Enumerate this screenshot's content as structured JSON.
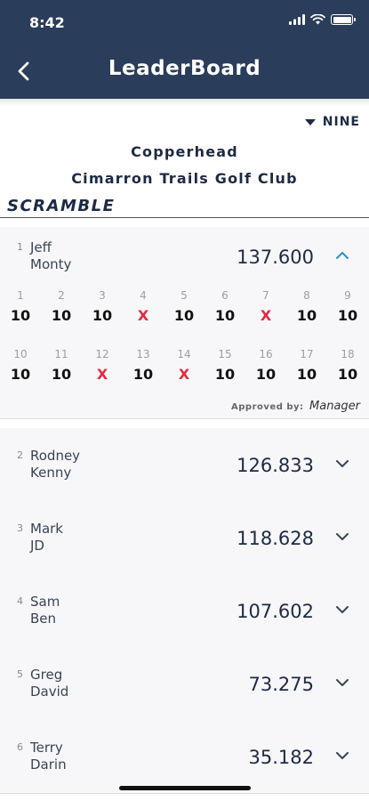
{
  "status": {
    "time": "8:42"
  },
  "nav": {
    "title": "LeaderBoard"
  },
  "filter": {
    "nine": "NINE"
  },
  "event": {
    "course": "Copperhead",
    "club": "Cimarron Trails Golf Club",
    "format": "SCRAMBLE"
  },
  "leader": {
    "rank": "1",
    "player1": "Jeff",
    "player2": "Monty",
    "score": "137.600",
    "holes": [
      {
        "num": "1",
        "score": "10"
      },
      {
        "num": "2",
        "score": "10"
      },
      {
        "num": "3",
        "score": "10"
      },
      {
        "num": "4",
        "score": "X"
      },
      {
        "num": "5",
        "score": "10"
      },
      {
        "num": "6",
        "score": "10"
      },
      {
        "num": "7",
        "score": "X"
      },
      {
        "num": "8",
        "score": "10"
      },
      {
        "num": "9",
        "score": "10"
      },
      {
        "num": "10",
        "score": "10"
      },
      {
        "num": "11",
        "score": "10"
      },
      {
        "num": "12",
        "score": "X"
      },
      {
        "num": "13",
        "score": "10"
      },
      {
        "num": "14",
        "score": "X"
      },
      {
        "num": "15",
        "score": "10"
      },
      {
        "num": "16",
        "score": "10"
      },
      {
        "num": "17",
        "score": "10"
      },
      {
        "num": "18",
        "score": "10"
      }
    ],
    "approved_label": "Approved by:",
    "approved_by": "Manager"
  },
  "rows": [
    {
      "rank": "2",
      "player1": "Rodney",
      "player2": "Kenny",
      "score": "126.833"
    },
    {
      "rank": "3",
      "player1": "Mark",
      "player2": "JD",
      "score": "118.628"
    },
    {
      "rank": "4",
      "player1": "Sam",
      "player2": "Ben",
      "score": "107.602"
    },
    {
      "rank": "5",
      "player1": "Greg",
      "player2": "David",
      "score": "73.275"
    },
    {
      "rank": "6",
      "player1": "Terry",
      "player2": "Darin",
      "score": "35.182"
    }
  ],
  "colors": {
    "nav_bg": "#2a3d5a",
    "x_mark": "#e8283c",
    "accent": "#2a90d0"
  }
}
